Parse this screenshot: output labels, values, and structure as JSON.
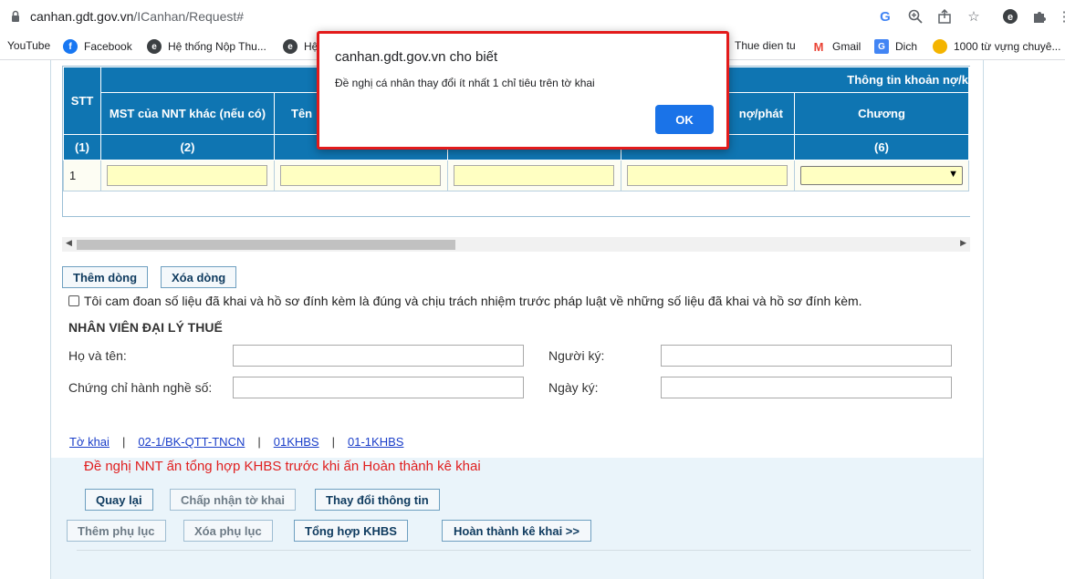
{
  "browser": {
    "url_host": "canhan.gdt.gov.vn",
    "url_path": "/ICanhan/Request#",
    "bookmarks": [
      {
        "label": "YouTube"
      },
      {
        "label": "Facebook"
      },
      {
        "label": "Hệ thống Nộp Thu..."
      },
      {
        "label": "Hệ"
      },
      {
        "label": "Thue dien tu"
      },
      {
        "label": "Gmail"
      },
      {
        "label": "Dich"
      },
      {
        "label": "1000 từ vựng chuyê..."
      }
    ]
  },
  "table": {
    "header_group": "Thông tin khoản nợ/k",
    "headers": {
      "stt": "STT",
      "mst": "MST của NNT khác (nếu có)",
      "ten": "Tên",
      "no_phat": "nợ/phát",
      "chuong": "Chương"
    },
    "numbers": [
      "(1)",
      "(2)",
      "(6)"
    ],
    "row_index": "1"
  },
  "actions": {
    "add_row": "Thêm dòng",
    "delete_row": "Xóa dòng"
  },
  "declaration": "Tôi cam đoan số liệu đã khai và hồ sơ đính kèm là đúng và chịu trách nhiệm trước pháp luật về những số liệu đã khai và hồ sơ đính kèm.",
  "agent": {
    "title": "NHÂN VIÊN ĐẠI LÝ THUẾ",
    "name_label": "Họ và tên:",
    "cert_label": "Chứng chỉ hành nghề số:",
    "signer_label": "Người ký:",
    "date_label": "Ngày ký:"
  },
  "tabs": {
    "items": [
      "Tờ khai",
      "02-1/BK-QTT-TNCN",
      "01KHBS",
      "01-1KHBS"
    ],
    "separator": "|"
  },
  "warning": "Đề nghị NNT ấn tổng hợp KHBS trước khi ấn Hoàn thành kê khai",
  "buttons": {
    "back": "Quay lại",
    "accept": "Chấp nhận tờ khai",
    "change_info": "Thay đổi thông tin",
    "add_appendix": "Thêm phụ lục",
    "delete_appendix": "Xóa phụ lục",
    "summarize": "Tổng hợp KHBS",
    "complete": "Hoàn thành kê khai >>"
  },
  "dialog": {
    "title": "canhan.gdt.gov.vn cho biết",
    "message": "Đề nghị cá nhân thay đổi ít nhất 1 chỉ tiêu trên tờ khai",
    "ok": "OK"
  }
}
